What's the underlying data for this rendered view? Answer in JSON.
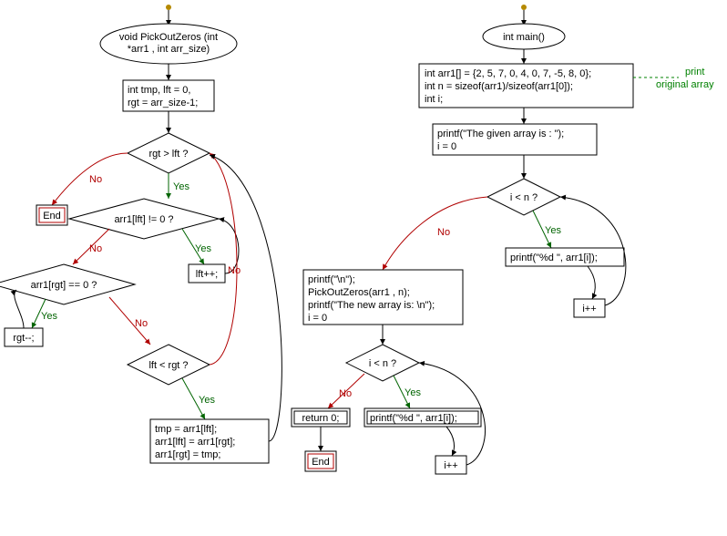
{
  "chart_data": {
    "type": "flowchart",
    "functions": [
      {
        "name": "PickOutZeros",
        "signature": "void PickOutZeros (int *arr1 , int arr_size)",
        "nodes": [
          {
            "id": "p_sig",
            "kind": "start",
            "text": "void PickOutZeros (int *arr1 , int arr_size)"
          },
          {
            "id": "p_init",
            "kind": "process",
            "text": "int tmp, lft = 0, rgt = arr_size-1;"
          },
          {
            "id": "p_q1",
            "kind": "decision",
            "text": "rgt > lft ?"
          },
          {
            "id": "p_end",
            "kind": "end",
            "text": "End"
          },
          {
            "id": "p_q2",
            "kind": "decision",
            "text": "arr1[lft] != 0 ?"
          },
          {
            "id": "p_lftpp",
            "kind": "process",
            "text": "lft++;"
          },
          {
            "id": "p_q3",
            "kind": "decision",
            "text": "arr1[rgt] == 0 ?"
          },
          {
            "id": "p_rgtmm",
            "kind": "process",
            "text": "rgt--;"
          },
          {
            "id": "p_q4",
            "kind": "decision",
            "text": "lft < rgt ?"
          },
          {
            "id": "p_swap",
            "kind": "process",
            "text": "tmp = arr1[lft];\narr1[lft] = arr1[rgt];\narr1[rgt] = tmp;"
          }
        ],
        "edges": [
          {
            "from": "p_sig",
            "to": "p_init"
          },
          {
            "from": "p_init",
            "to": "p_q1"
          },
          {
            "from": "p_q1",
            "to": "p_end",
            "label": "No"
          },
          {
            "from": "p_q1",
            "to": "p_q2",
            "label": "Yes"
          },
          {
            "from": "p_q2",
            "to": "p_lftpp",
            "label": "Yes"
          },
          {
            "from": "p_lftpp",
            "to": "p_q2"
          },
          {
            "from": "p_q2",
            "to": "p_q3",
            "label": "No"
          },
          {
            "from": "p_q3",
            "to": "p_rgtmm",
            "label": "Yes"
          },
          {
            "from": "p_rgtmm",
            "to": "p_q3"
          },
          {
            "from": "p_q3",
            "to": "p_q4",
            "label": "No"
          },
          {
            "from": "p_q4",
            "to": "p_swap",
            "label": "Yes"
          },
          {
            "from": "p_q4",
            "to": "p_q1",
            "label": "No"
          },
          {
            "from": "p_swap",
            "to": "p_q1"
          }
        ]
      },
      {
        "name": "main",
        "signature": "int main()",
        "nodes": [
          {
            "id": "m_sig",
            "kind": "start",
            "text": "int main()"
          },
          {
            "id": "m_init",
            "kind": "process",
            "text": "int arr1[] = {2, 5, 7, 0, 4, 0, 7, -5, 8, 0};\nint n = sizeof(arr1)/sizeof(arr1[0]);\nint i;",
            "comment": "print original array"
          },
          {
            "id": "m_p1",
            "kind": "process",
            "text": "printf(\"The given array is :  \");\ni = 0"
          },
          {
            "id": "m_q1",
            "kind": "decision",
            "text": "i < n ?"
          },
          {
            "id": "m_pr1",
            "kind": "process",
            "text": "printf(\"%d  \", arr1[i]);"
          },
          {
            "id": "m_inc1",
            "kind": "process",
            "text": "i++"
          },
          {
            "id": "m_call",
            "kind": "process",
            "text": "printf(\"\\n\");\nPickOutZeros(arr1 , n);\nprintf(\"The new array is: \\n\");\ni = 0"
          },
          {
            "id": "m_q2",
            "kind": "decision",
            "text": "i < n ?"
          },
          {
            "id": "m_pr2",
            "kind": "process",
            "text": "printf(\"%d  \", arr1[i]);"
          },
          {
            "id": "m_inc2",
            "kind": "process",
            "text": "i++"
          },
          {
            "id": "m_ret",
            "kind": "process",
            "text": "return 0;"
          },
          {
            "id": "m_end",
            "kind": "end",
            "text": "End"
          }
        ],
        "edges": [
          {
            "from": "m_sig",
            "to": "m_init"
          },
          {
            "from": "m_init",
            "to": "m_p1"
          },
          {
            "from": "m_p1",
            "to": "m_q1"
          },
          {
            "from": "m_q1",
            "to": "m_pr1",
            "label": "Yes"
          },
          {
            "from": "m_pr1",
            "to": "m_inc1"
          },
          {
            "from": "m_inc1",
            "to": "m_q1"
          },
          {
            "from": "m_q1",
            "to": "m_call",
            "label": "No"
          },
          {
            "from": "m_call",
            "to": "m_q2"
          },
          {
            "from": "m_q2",
            "to": "m_pr2",
            "label": "Yes"
          },
          {
            "from": "m_pr2",
            "to": "m_inc2"
          },
          {
            "from": "m_inc2",
            "to": "m_q2"
          },
          {
            "from": "m_q2",
            "to": "m_ret",
            "label": "No"
          },
          {
            "from": "m_ret",
            "to": "m_end"
          }
        ]
      }
    ]
  },
  "labels": {
    "yes": "Yes",
    "no": "No",
    "end": "End",
    "comment1": "print",
    "comment2": "original array",
    "p_sig_l1": "void PickOutZeros (int",
    "p_sig_l2": "*arr1 , int arr_size)",
    "p_init_l1": "int tmp, lft = 0,",
    "p_init_l2": "rgt = arr_size-1;",
    "p_q1": "rgt > lft ?",
    "p_q2": "arr1[lft] != 0 ?",
    "p_lftpp": "lft++;",
    "p_q3": "arr1[rgt] == 0 ?",
    "p_rgtmm": "rgt--;",
    "p_q4": "lft < rgt ?",
    "p_swap_l1": "tmp = arr1[lft];",
    "p_swap_l2": "arr1[lft] = arr1[rgt];",
    "p_swap_l3": "arr1[rgt] = tmp;",
    "m_sig": "int main()",
    "m_init_l1": "int arr1[] = {2, 5, 7, 0, 4, 0, 7, -5, 8, 0};",
    "m_init_l2": "int n = sizeof(arr1)/sizeof(arr1[0]);",
    "m_init_l3": "int i;",
    "m_p1_l1": "printf(\"The given array is :  \");",
    "m_p1_l2": "i = 0",
    "m_q1": "i < n ?",
    "m_pr1": "printf(\"%d  \", arr1[i]);",
    "m_inc1": "i++",
    "m_call_l1": "printf(\"\\n\");",
    "m_call_l2": "PickOutZeros(arr1 , n);",
    "m_call_l3": "printf(\"The new array is: \\n\");",
    "m_call_l4": "i = 0",
    "m_q2": "i < n ?",
    "m_pr2": "printf(\"%d  \", arr1[i]);",
    "m_inc2": "i++",
    "m_ret": "return 0;"
  }
}
